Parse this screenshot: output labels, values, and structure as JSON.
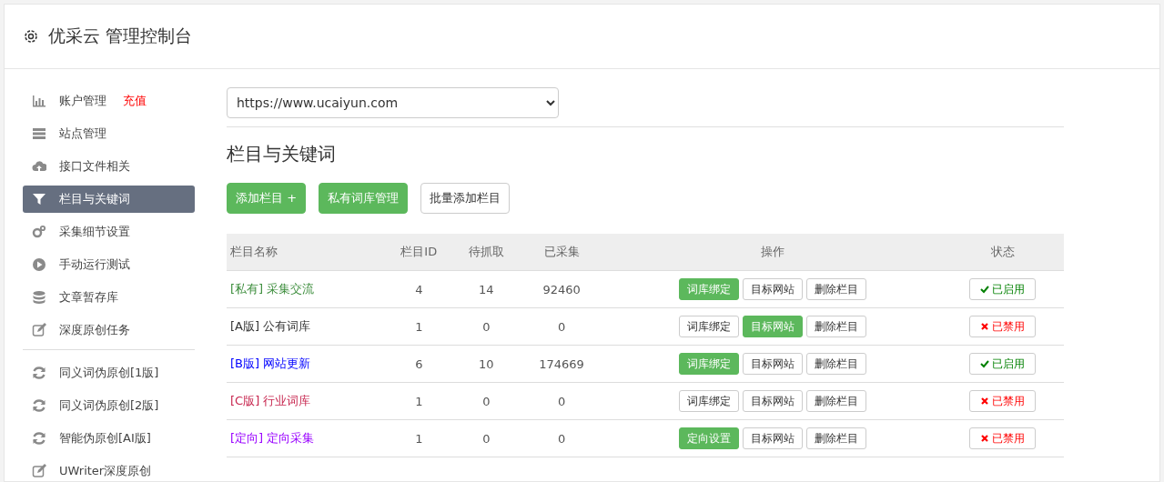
{
  "header": {
    "title": "优采云 管理控制台"
  },
  "sidebar": {
    "groups": [
      {
        "items": [
          {
            "label": "账户管理",
            "badge": "充值",
            "selected": false
          },
          {
            "label": "站点管理",
            "selected": false
          },
          {
            "label": "接口文件相关",
            "selected": false
          },
          {
            "label": "栏目与关键词",
            "selected": true
          },
          {
            "label": "采集细节设置",
            "selected": false
          },
          {
            "label": "手动运行测试",
            "selected": false
          },
          {
            "label": "文章暂存库",
            "selected": false
          },
          {
            "label": "深度原创任务",
            "selected": false
          }
        ]
      },
      {
        "items": [
          {
            "label": "同义词伪原创[1版]",
            "selected": false
          },
          {
            "label": "同义词伪原创[2版]",
            "selected": false
          },
          {
            "label": "智能伪原创[AI版]",
            "selected": false
          },
          {
            "label": "UWriter深度原创",
            "selected": false
          }
        ]
      }
    ]
  },
  "site_select": {
    "value": "https://www.ucaiyun.com"
  },
  "section_title": "栏目与关键词",
  "toolbar": [
    {
      "label": "添加栏目 +",
      "kind": "primary"
    },
    {
      "label": "私有词库管理",
      "kind": "primary"
    },
    {
      "label": "批量添加栏目",
      "kind": "default"
    }
  ],
  "table": {
    "columns": [
      "栏目名称",
      "栏目ID",
      "待抓取",
      "已采集",
      "操作",
      "状态"
    ],
    "rows": [
      {
        "tag": "[私有]",
        "name": "采集交流",
        "color": "#3c8d3c",
        "id": "4",
        "pending": "14",
        "collected": "92460",
        "actions": [
          {
            "label": "词库绑定",
            "highlighted": true
          },
          {
            "label": "目标网站",
            "highlighted": false
          },
          {
            "label": "删除栏目",
            "highlighted": false
          }
        ],
        "status": "已启用",
        "enabled": true
      },
      {
        "tag": "[A版]",
        "name": "公有词库",
        "color": "#333333",
        "id": "1",
        "pending": "0",
        "collected": "0",
        "actions": [
          {
            "label": "词库绑定",
            "highlighted": false
          },
          {
            "label": "目标网站",
            "highlighted": true
          },
          {
            "label": "删除栏目",
            "highlighted": false
          }
        ],
        "status": "已禁用",
        "enabled": false
      },
      {
        "tag": "[B版]",
        "name": "网站更新",
        "color": "#0000ff",
        "id": "6",
        "pending": "10",
        "collected": "174669",
        "actions": [
          {
            "label": "词库绑定",
            "highlighted": true
          },
          {
            "label": "目标网站",
            "highlighted": false
          },
          {
            "label": "删除栏目",
            "highlighted": false
          }
        ],
        "status": "已启用",
        "enabled": true
      },
      {
        "tag": "[C版]",
        "name": "行业词库",
        "color": "#c7254e",
        "id": "1",
        "pending": "0",
        "collected": "0",
        "actions": [
          {
            "label": "词库绑定",
            "highlighted": false
          },
          {
            "label": "目标网站",
            "highlighted": false
          },
          {
            "label": "删除栏目",
            "highlighted": false
          }
        ],
        "status": "已禁用",
        "enabled": false
      },
      {
        "tag": "[定向]",
        "name": "定向采集",
        "color": "#9900ff",
        "id": "1",
        "pending": "0",
        "collected": "0",
        "actions": [
          {
            "label": "定向设置",
            "highlighted": true
          },
          {
            "label": "目标网站",
            "highlighted": false
          },
          {
            "label": "删除栏目",
            "highlighted": false
          }
        ],
        "status": "已禁用",
        "enabled": false
      }
    ]
  }
}
